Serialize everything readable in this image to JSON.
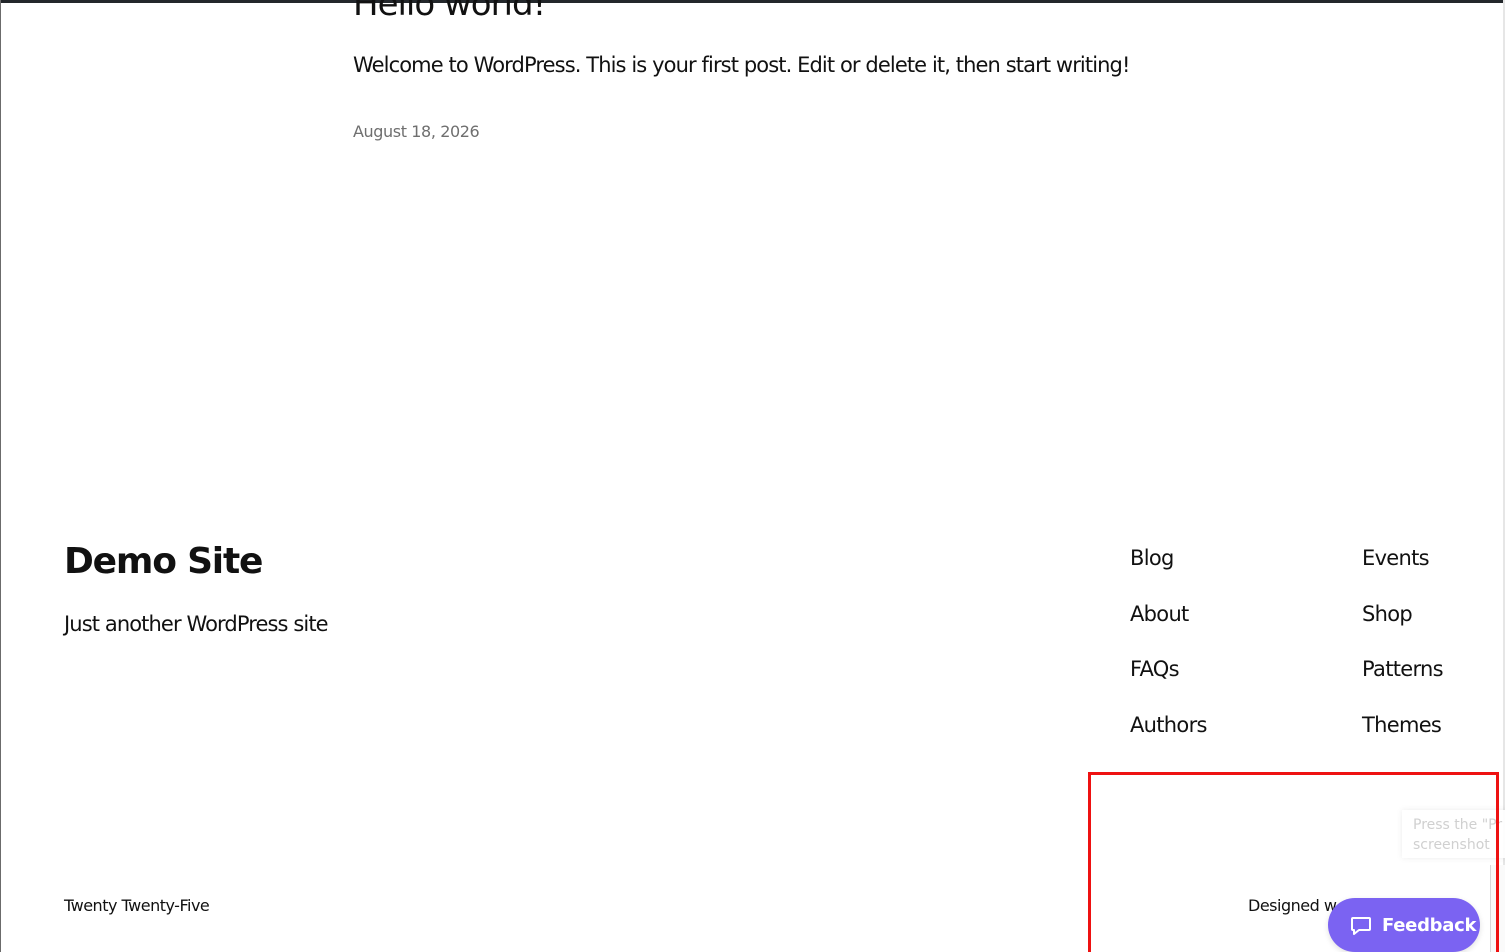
{
  "post": {
    "title": "Hello world!",
    "excerpt": "Welcome to WordPress. This is your first post. Edit or delete it, then start writing!",
    "date": "August 18, 2026"
  },
  "footer": {
    "site_title": "Demo Site",
    "tagline": "Just another WordPress site",
    "nav_column_1": [
      {
        "label": "Blog"
      },
      {
        "label": "About"
      },
      {
        "label": "FAQs"
      },
      {
        "label": "Authors"
      }
    ],
    "nav_column_2": [
      {
        "label": "Events"
      },
      {
        "label": "Shop"
      },
      {
        "label": "Patterns"
      },
      {
        "label": "Themes"
      }
    ],
    "theme_credit": "Twenty Twenty-Five",
    "designed_credit": "Designed w"
  },
  "overlay": {
    "toast_line_1": "Press the \"Pr",
    "toast_line_2": "screenshot",
    "feedback_label": "Feedback",
    "feedback_icon": "chat-bubble-icon",
    "highlight_color": "#ee1111",
    "feedback_color": "#7b63f2"
  }
}
